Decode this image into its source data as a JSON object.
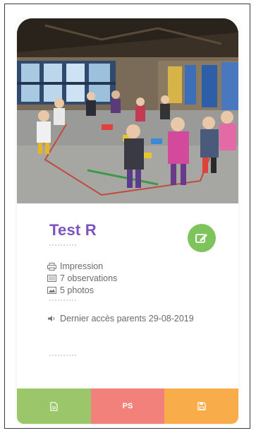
{
  "card": {
    "title": "Test R",
    "details": {
      "print": "Impression",
      "observations": "7 observations",
      "photos": "5 photos"
    },
    "last_access": "Dernier accès parents 29-08-2019"
  },
  "actions": {
    "pdf_icon": "document-icon",
    "ps_label": "PS",
    "save_icon": "save-icon"
  },
  "colors": {
    "title": "#7c54c2",
    "edit": "#7ec35b",
    "green": "#9bc66a",
    "red": "#f1817a",
    "orange": "#f8ad4a"
  }
}
